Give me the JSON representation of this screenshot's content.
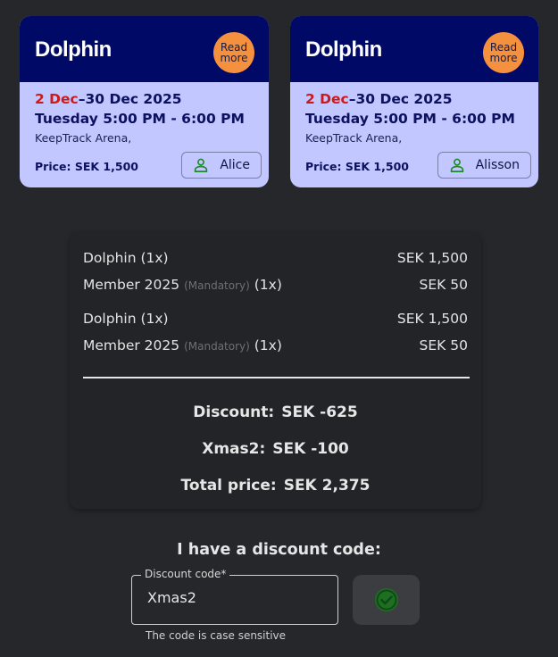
{
  "tickets": [
    {
      "title": "Dolphin",
      "read_more": "Read more",
      "date_start": "2 Dec",
      "date_rest": "–30 Dec 2025",
      "time": "Tuesday 5:00 PM - 6:00 PM",
      "venue": "KeepTrack Arena,",
      "price": "Price: SEK 1,500",
      "attendee": "Alice"
    },
    {
      "title": "Dolphin",
      "read_more": "Read more",
      "date_start": "2 Dec",
      "date_rest": "–30 Dec 2025",
      "time": "Tuesday 5:00 PM - 6:00 PM",
      "venue": "KeepTrack Arena,",
      "price": "Price: SEK 1,500",
      "attendee": "Alisson"
    }
  ],
  "summary": {
    "lines": [
      {
        "name": "Dolphin",
        "mandatory": "",
        "qty": "(1x)",
        "amount": "SEK 1,500"
      },
      {
        "name": "Member 2025",
        "mandatory": "(Mandatory)",
        "qty": "(1x)",
        "amount": "SEK 50"
      },
      {
        "name": "Dolphin",
        "mandatory": "",
        "qty": "(1x)",
        "amount": "SEK 1,500"
      },
      {
        "name": "Member 2025",
        "mandatory": "(Mandatory)",
        "qty": "(1x)",
        "amount": "SEK 50"
      }
    ],
    "discount_label": "Discount:",
    "discount_value": "SEK -625",
    "code_label": "Xmas2:",
    "code_value": "SEK -100",
    "total_label": "Total price:",
    "total_value": "SEK 2,375"
  },
  "discount": {
    "heading": "I have a discount code:",
    "field_label": "Discount code*",
    "value": "Xmas2",
    "helper": "The code is case sensitive"
  },
  "colors": {
    "background": "#26272b",
    "card_header": "#000a66",
    "card_body": "#c2c7ff",
    "read_more": "#f5913e",
    "date_accent": "#cc1a1a",
    "apply_check": "#1f8a2a"
  },
  "icons": {
    "attendee": "person-icon",
    "apply": "check-circle-icon"
  }
}
